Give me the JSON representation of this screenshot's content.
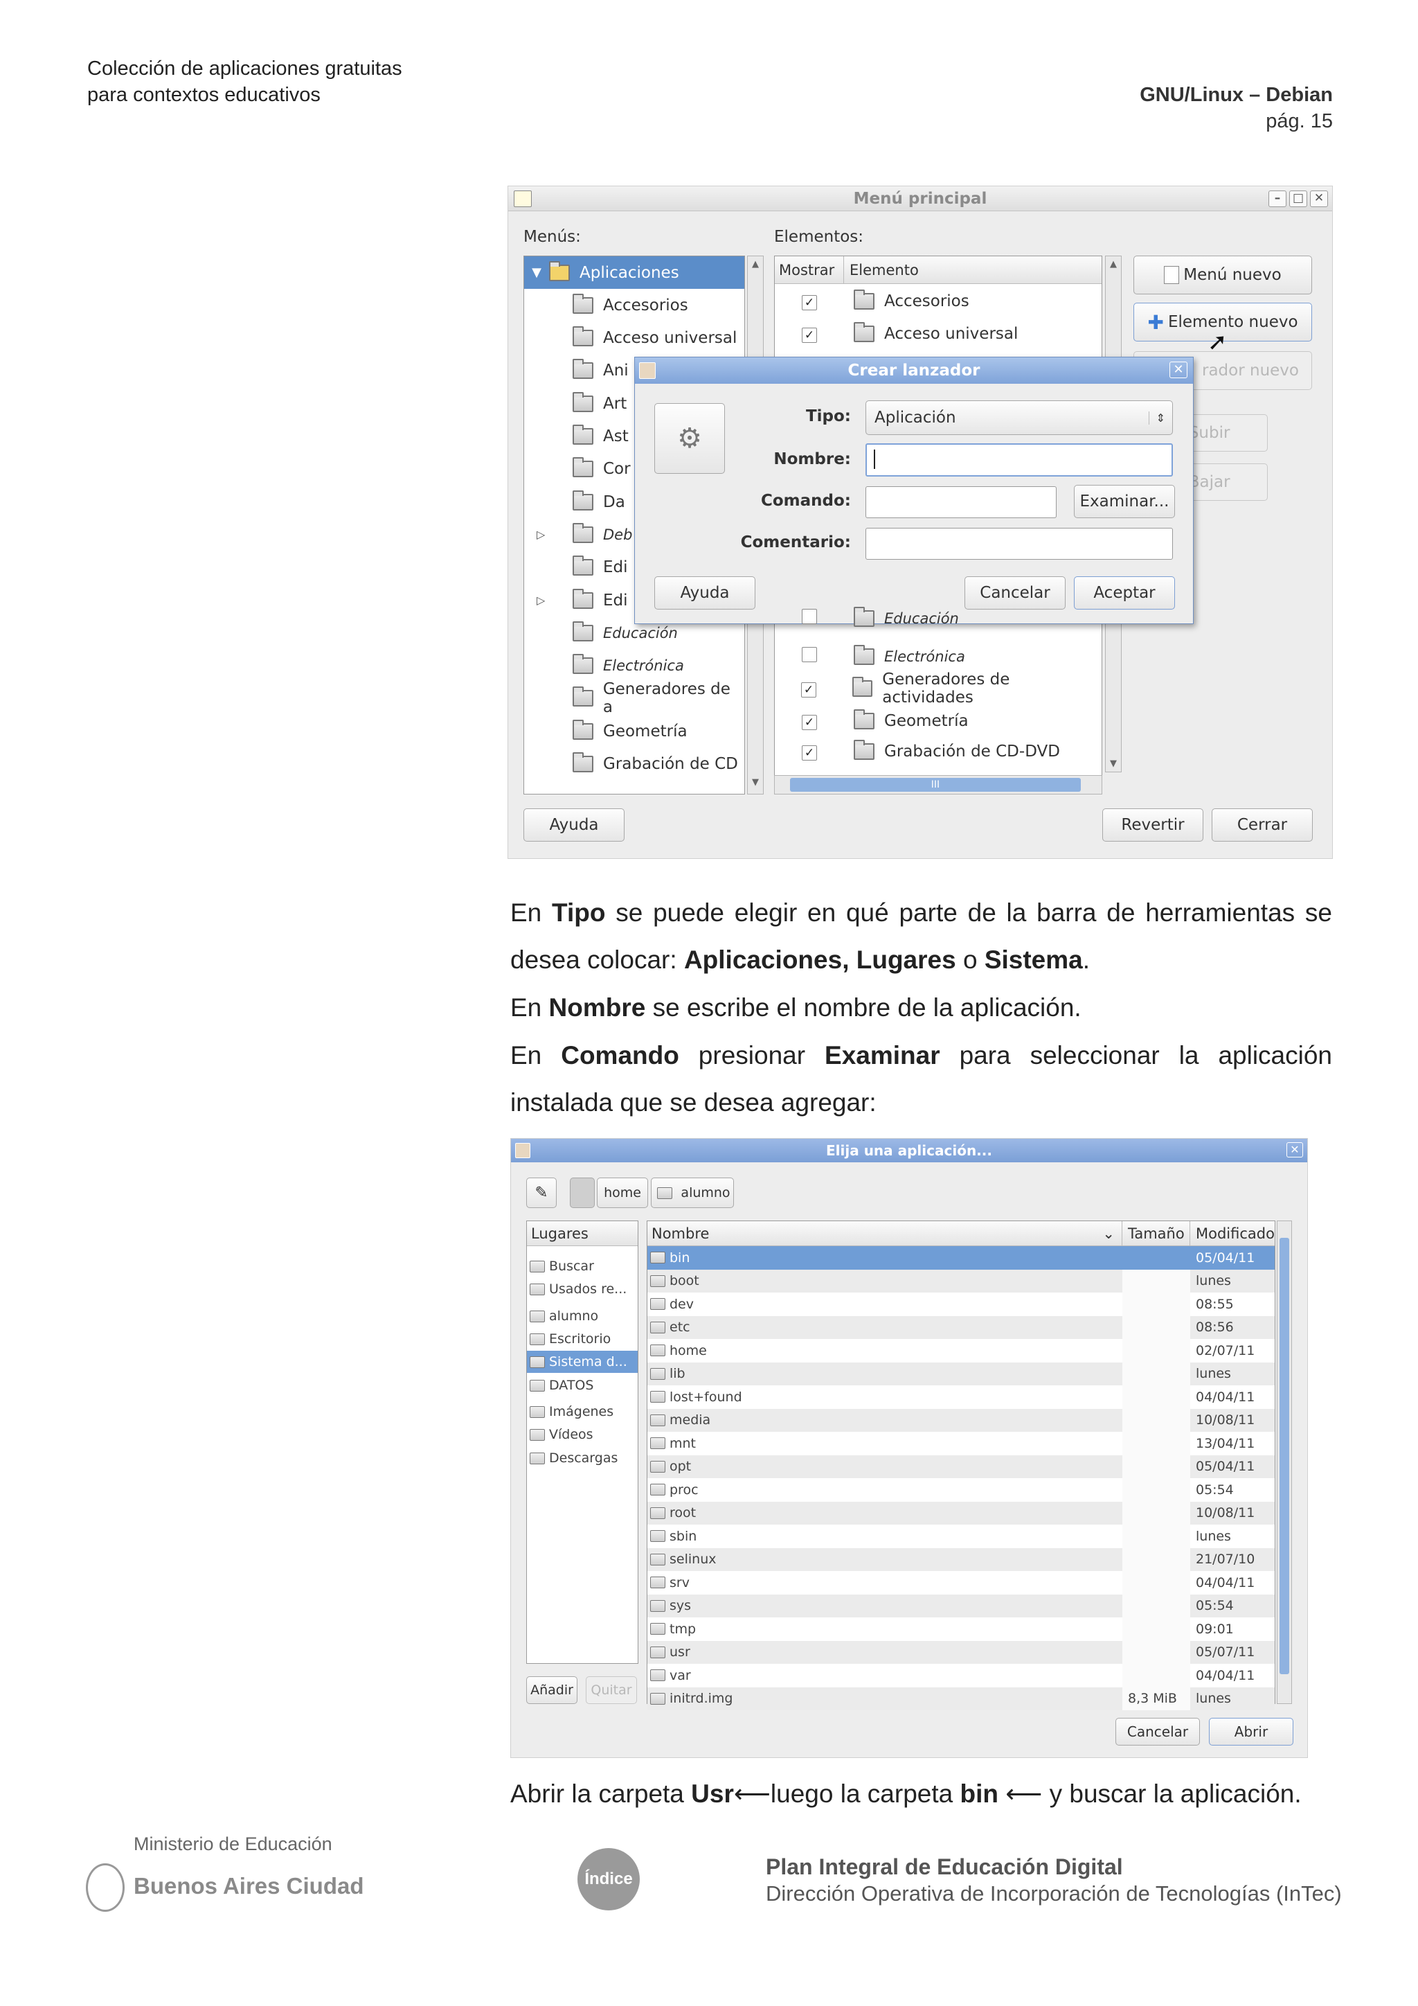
{
  "header": {
    "left_line1": "Colección de aplicaciones gratuitas",
    "left_line2": "para contextos educativos",
    "right_line1": "GNU/Linux – Debian",
    "right_line2": "pág. 15"
  },
  "menu_window": {
    "title": "Menú principal",
    "menus_label": "Menús:",
    "elements_label": "Elementos:",
    "col_show": "Mostrar",
    "col_element": "Elemento",
    "tree": [
      "Aplicaciones",
      "Accesorios",
      "Acceso universal",
      "Ani",
      "Art",
      "Ast",
      "Cor",
      "Da",
      "Deb",
      "Edi",
      "Edi",
      "Educación",
      "Electrónica",
      "Generadores de a",
      "Geometría",
      "Grabación de CD"
    ],
    "elements_top": [
      "Accesorios",
      "Acceso universal"
    ],
    "elements_bottom": [
      "Educación",
      "Electrónica",
      "Generadores de actividades",
      "Geometría",
      "Grabación de CD-DVD"
    ],
    "btn_new_menu": "Menú nuevo",
    "btn_new_item": "Elemento nuevo",
    "btn_new_sep": "rador nuevo",
    "btn_up": "Subir",
    "btn_down": "Bajar",
    "btn_help": "Ayuda",
    "btn_revert": "Revertir",
    "btn_close": "Cerrar",
    "hscroll_mark": "III"
  },
  "launcher_dialog": {
    "title": "Crear lanzador",
    "type_label": "Tipo:",
    "type_value": "Aplicación",
    "name_label": "Nombre:",
    "name_value": "",
    "command_label": "Comando:",
    "command_value": "",
    "browse_btn": "Examinar...",
    "comment_label": "Comentario:",
    "comment_value": "",
    "help_btn": "Ayuda",
    "cancel_btn": "Cancelar",
    "ok_btn": "Aceptar"
  },
  "paragraphs": {
    "p1_a": "En ",
    "p1_b": "Tipo",
    "p1_c": " se puede elegir en qué parte de la barra de herramientas se desea colocar: ",
    "p1_d": "Aplicaciones, Lugares",
    "p1_e": " o ",
    "p1_f": "Sistema",
    "p1_g": ".",
    "p2_a": "En ",
    "p2_b": "Nombre",
    "p2_c": " se escribe el nombre de la aplicación.",
    "p3_a": "En ",
    "p3_b": "Comando",
    "p3_c": " presionar ",
    "p3_d": "Examinar",
    "p3_e": " para seleccionar la aplicación instalada que se desea agregar:",
    "p4_a": "Abrir la carpeta ",
    "p4_b": "Usr",
    "p4_c": "luego la carpeta ",
    "p4_d": "bin",
    "p4_e": " y buscar la aplicación."
  },
  "chooser": {
    "title": "Elija una aplicación...",
    "path": [
      "home",
      "alumno"
    ],
    "places_header": "Lugares",
    "places": [
      "Buscar",
      "Usados re...",
      "alumno",
      "Escritorio",
      "Sistema d...",
      "DATOS",
      "Imágenes",
      "Vídeos",
      "Descargas"
    ],
    "add_btn": "Añadir",
    "remove_btn": "Quitar",
    "col_name": "Nombre",
    "col_size": "Tamaño",
    "col_modified": "Modificado",
    "files": [
      {
        "name": "bin",
        "size": "",
        "date": "05/04/11"
      },
      {
        "name": "boot",
        "size": "",
        "date": "lunes"
      },
      {
        "name": "dev",
        "size": "",
        "date": "08:55"
      },
      {
        "name": "etc",
        "size": "",
        "date": "08:56"
      },
      {
        "name": "home",
        "size": "",
        "date": "02/07/11"
      },
      {
        "name": "lib",
        "size": "",
        "date": "lunes"
      },
      {
        "name": "lost+found",
        "size": "",
        "date": "04/04/11"
      },
      {
        "name": "media",
        "size": "",
        "date": "10/08/11"
      },
      {
        "name": "mnt",
        "size": "",
        "date": "13/04/11"
      },
      {
        "name": "opt",
        "size": "",
        "date": "05/04/11"
      },
      {
        "name": "proc",
        "size": "",
        "date": "05:54"
      },
      {
        "name": "root",
        "size": "",
        "date": "10/08/11"
      },
      {
        "name": "sbin",
        "size": "",
        "date": "lunes"
      },
      {
        "name": "selinux",
        "size": "",
        "date": "21/07/10"
      },
      {
        "name": "srv",
        "size": "",
        "date": "04/04/11"
      },
      {
        "name": "sys",
        "size": "",
        "date": "05:54"
      },
      {
        "name": "tmp",
        "size": "",
        "date": "09:01"
      },
      {
        "name": "usr",
        "size": "",
        "date": "05/07/11"
      },
      {
        "name": "var",
        "size": "",
        "date": "04/04/11"
      },
      {
        "name": "initrd.img",
        "size": "8,3 MiB",
        "date": "lunes"
      }
    ],
    "cancel_btn": "Cancelar",
    "open_btn": "Abrir"
  },
  "footer": {
    "ministry": "Ministerio de Educación",
    "city": "Buenos Aires Ciudad",
    "index_btn": "Índice",
    "plan": "Plan Integral de Educación Digital",
    "direction": "Dirección Operativa de Incorporación de Tecnologías (InTec)"
  },
  "colors": {
    "selection": "#5b8dc9",
    "dialog_title": "#7fa3d9",
    "index_badge": "#9a9a9a"
  }
}
